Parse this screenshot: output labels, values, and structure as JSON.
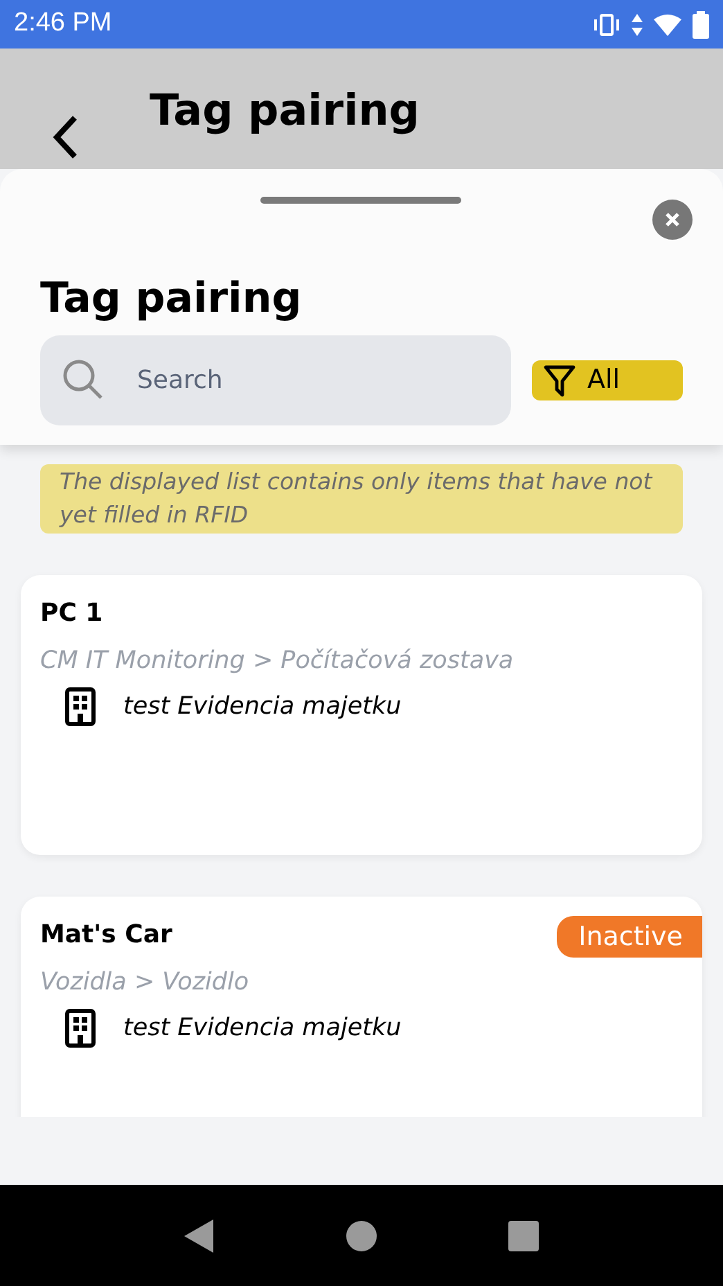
{
  "status_bar": {
    "time": "2:46 PM"
  },
  "background_header": {
    "title": "Tag pairing"
  },
  "sheet": {
    "title": "Tag pairing",
    "search": {
      "placeholder": "Search"
    },
    "filter": {
      "label": "All"
    },
    "notice": "The displayed list contains only items that have not yet filled in RFID",
    "items": [
      {
        "name": "PC 1",
        "path": "CM IT Monitoring > Počítačová zostava",
        "location": "test Evidencia majetku"
      },
      {
        "name": "Mat's Car",
        "path": "Vozidla > Vozidlo",
        "location": "test Evidencia majetku",
        "badge": "Inactive"
      }
    ]
  }
}
